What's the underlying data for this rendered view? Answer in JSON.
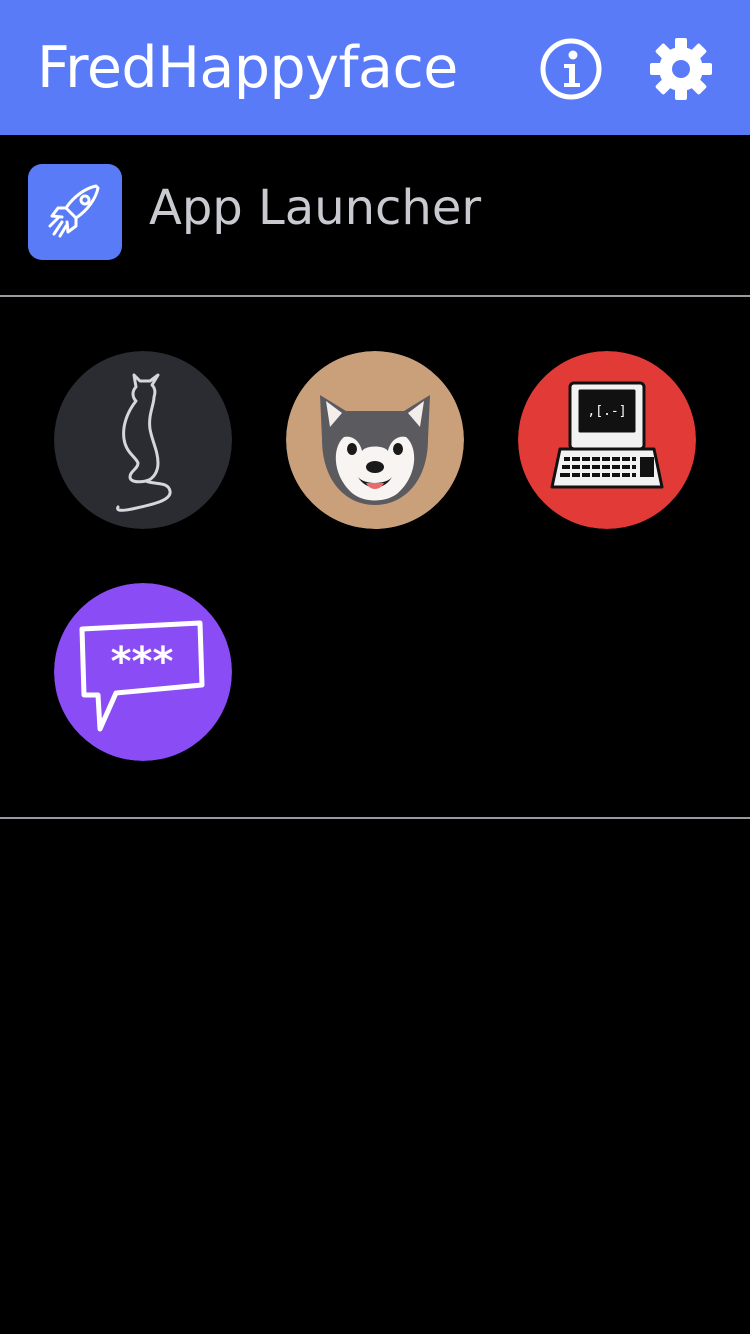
{
  "header": {
    "title": "FredHappyface",
    "info_icon": "info-icon",
    "settings_icon": "gear-icon",
    "background": "#5a7bf7"
  },
  "launcher": {
    "label": "App Launcher",
    "icon": "rocket-icon"
  },
  "apps": [
    {
      "icon": "cat-icon",
      "background": "#2a2c31"
    },
    {
      "icon": "shiba-dog-icon",
      "background": "#c9a07a"
    },
    {
      "icon": "retro-computer-icon",
      "background": "#e23a36"
    },
    {
      "icon": "password-chat-icon",
      "background": "#8a4cf5"
    }
  ]
}
